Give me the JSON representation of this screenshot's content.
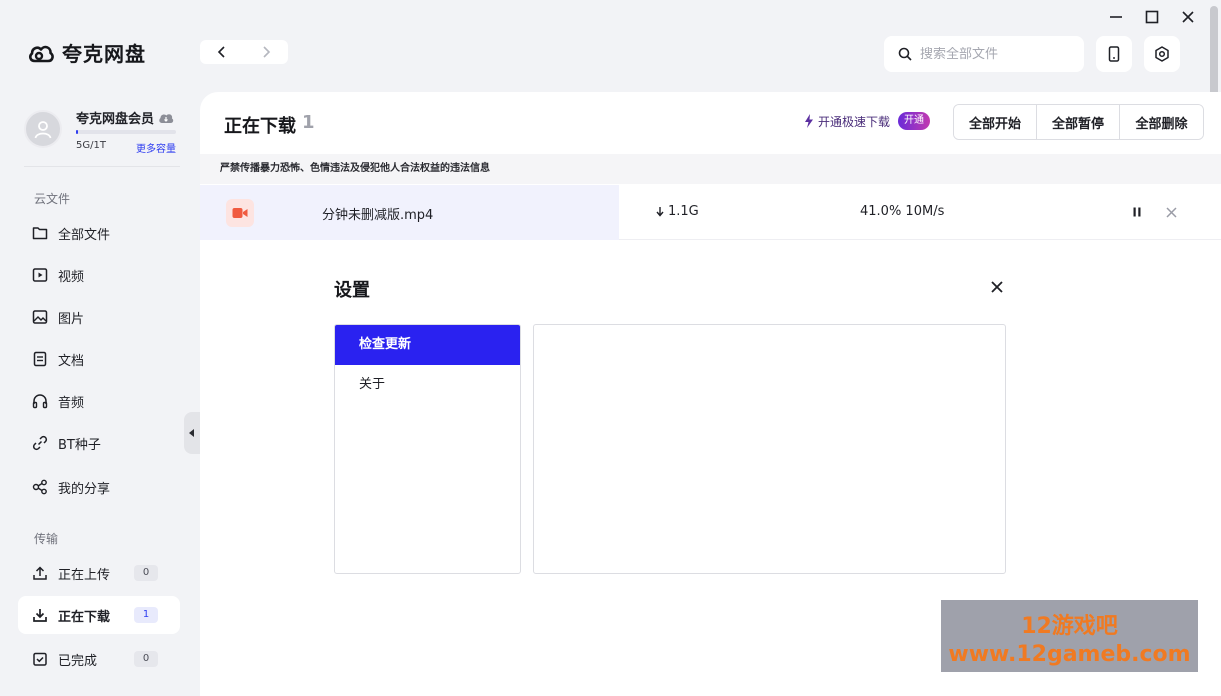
{
  "app": {
    "name": "夸克网盘"
  },
  "user": {
    "name": "夸克网盘会员",
    "capacity": "5G/1T",
    "capacity_ratio": 0.005,
    "more_capacity": "更多容量"
  },
  "sidebar": {
    "cloud_section": "云文件",
    "cloud_items": [
      {
        "label": "全部文件",
        "icon": "folder-icon"
      },
      {
        "label": "视频",
        "icon": "video-icon"
      },
      {
        "label": "图片",
        "icon": "image-icon"
      },
      {
        "label": "文档",
        "icon": "document-icon"
      },
      {
        "label": "音频",
        "icon": "headphones-icon"
      },
      {
        "label": "BT种子",
        "icon": "link-icon"
      },
      {
        "label": "我的分享",
        "icon": "share-icon"
      }
    ],
    "transfer_section": "传输",
    "transfer_items": [
      {
        "label": "正在上传",
        "count": "0",
        "icon": "upload-icon"
      },
      {
        "label": "正在下载",
        "count": "1",
        "icon": "download-icon"
      },
      {
        "label": "已完成",
        "count": "0",
        "icon": "completed-icon"
      }
    ]
  },
  "search": {
    "placeholder": "搜索全部文件"
  },
  "main": {
    "title": "正在下载",
    "count": "1",
    "speedup_label": "开通极速下载",
    "speedup_tag": "开通",
    "actions": {
      "start_all": "全部开始",
      "pause_all": "全部暂停",
      "delete_all": "全部删除"
    },
    "notice": "严禁传播暴力恐怖、色情违法及侵犯他人合法权益的违法信息"
  },
  "download": {
    "name": "分钟未删减版.mp4",
    "size": "1.1G",
    "progress_text": "41.0% 10M/s",
    "progress": 0.41
  },
  "settings": {
    "title": "设置",
    "menu": [
      {
        "label": "检查更新"
      },
      {
        "label": "关于"
      }
    ]
  },
  "watermark": {
    "line1": "12游戏吧",
    "line2": "www.12gameb.com"
  },
  "colors": {
    "accent": "#2e3df0",
    "menu_active": "#2a22f0",
    "progress_bg": "#f1f2fd",
    "watermark_text": "#f07a22"
  }
}
